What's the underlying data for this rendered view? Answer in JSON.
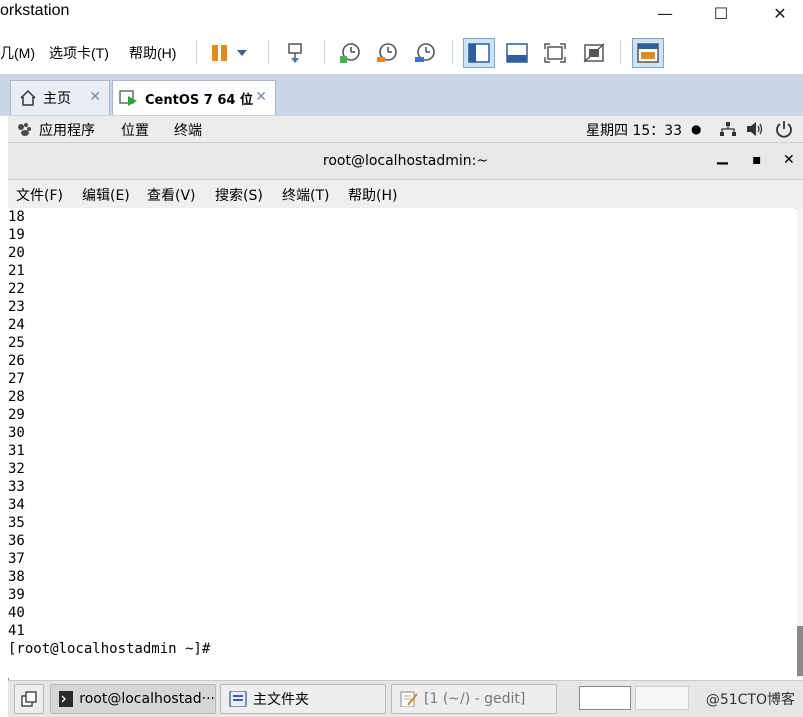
{
  "vmware": {
    "title": "orkstation",
    "window_controls": {
      "minimize": "—",
      "maximize": "☐",
      "close": "✕"
    },
    "menu": [
      "几(M)",
      "选项卡(T)",
      "帮助(H)"
    ]
  },
  "tabs": [
    {
      "label": "主页",
      "close": "✕"
    },
    {
      "label": "CentOS 7 64 位",
      "close": "✕"
    }
  ],
  "gnome_top": {
    "apps": "应用程序",
    "places": "位置",
    "terminal": "终端",
    "clock": "星期四 15：33",
    "dot": "●"
  },
  "terminal": {
    "title": "root@localhostadmin:~",
    "controls": {
      "minimize": "▁",
      "maximize": "▪",
      "close": "✕"
    },
    "menu": [
      "文件(F)",
      "编辑(E)",
      "查看(V)",
      "搜索(S)",
      "终端(T)",
      "帮助(H)"
    ],
    "lines": [
      "18",
      "19",
      "20",
      "21",
      "22",
      "23",
      "24",
      "25",
      "26",
      "27",
      "28",
      "29",
      "30",
      "31",
      "32",
      "33",
      "34",
      "35",
      "36",
      "37",
      "38",
      "39",
      "40",
      "41"
    ],
    "prompt": "[root@localhostadmin ~]#"
  },
  "taskbar": {
    "items": [
      {
        "label": "root@localhostad···"
      },
      {
        "label": "主文件夹"
      },
      {
        "label": "[1 (~/) - gedit]"
      }
    ],
    "watermark": "@51CTO博客"
  }
}
